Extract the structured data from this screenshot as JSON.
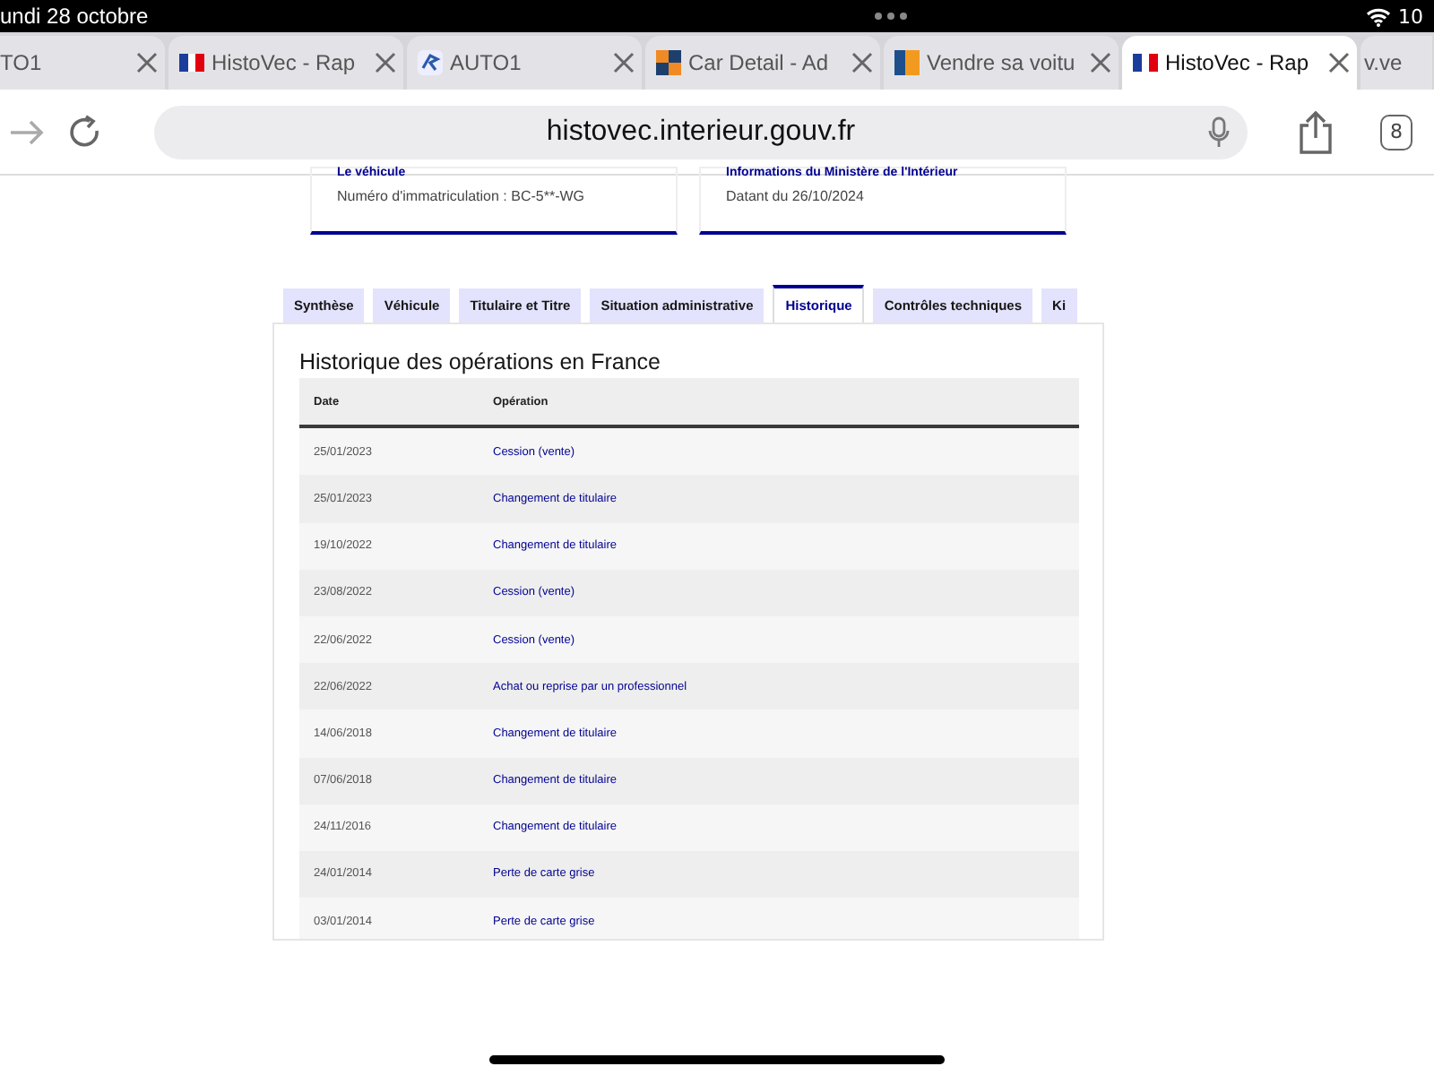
{
  "status_bar": {
    "date": "undi 28 octobre",
    "battery": "10"
  },
  "browser_tabs": [
    {
      "title": "TO1",
      "selected": false
    },
    {
      "title": "HistoVec - Rap",
      "kind": "flag",
      "selected": false
    },
    {
      "title": "AUTO1",
      "kind": "auto",
      "selected": false
    },
    {
      "title": "Car Detail - Ad",
      "kind": "squares",
      "selected": false
    },
    {
      "title": "Vendre sa voitu",
      "kind": "block",
      "selected": false
    },
    {
      "title": "HistoVec - Rap",
      "kind": "flag",
      "selected": true
    },
    {
      "title": "v.ve",
      "selected": false
    }
  ],
  "address_bar": {
    "url": "histovec.interieur.gouv.fr",
    "tab_count": "8"
  },
  "cards": [
    {
      "title": "Le véhicule",
      "text": "Numéro d'immatriculation : BC-5**-WG"
    },
    {
      "title": "Informations du Ministère de l'Intérieur",
      "text": "Datant du 26/10/2024"
    }
  ],
  "section_tabs": [
    {
      "label": "Synthèse",
      "selected": false
    },
    {
      "label": "Véhicule",
      "selected": false
    },
    {
      "label": "Titulaire et Titre",
      "selected": false
    },
    {
      "label": "Situation administrative",
      "selected": false
    },
    {
      "label": "Historique",
      "selected": true
    },
    {
      "label": "Contrôles techniques",
      "selected": false
    },
    {
      "label": "Ki",
      "selected": false
    }
  ],
  "history": {
    "title": "Historique des opérations en France",
    "columns": [
      "Date",
      "Opération"
    ],
    "rows": [
      [
        "25/01/2023",
        "Cession (vente)"
      ],
      [
        "25/01/2023",
        "Changement de titulaire"
      ],
      [
        "19/10/2022",
        "Changement de titulaire"
      ],
      [
        "23/08/2022",
        "Cession (vente)"
      ],
      [
        "22/06/2022",
        "Cession (vente)"
      ],
      [
        "22/06/2022",
        "Achat ou reprise par un professionnel"
      ],
      [
        "14/06/2018",
        "Changement de titulaire"
      ],
      [
        "07/06/2018",
        "Changement de titulaire"
      ],
      [
        "24/11/2016",
        "Changement de titulaire"
      ],
      [
        "24/01/2014",
        "Perte de carte grise"
      ],
      [
        "03/01/2014",
        "Perte de carte grise"
      ]
    ]
  }
}
